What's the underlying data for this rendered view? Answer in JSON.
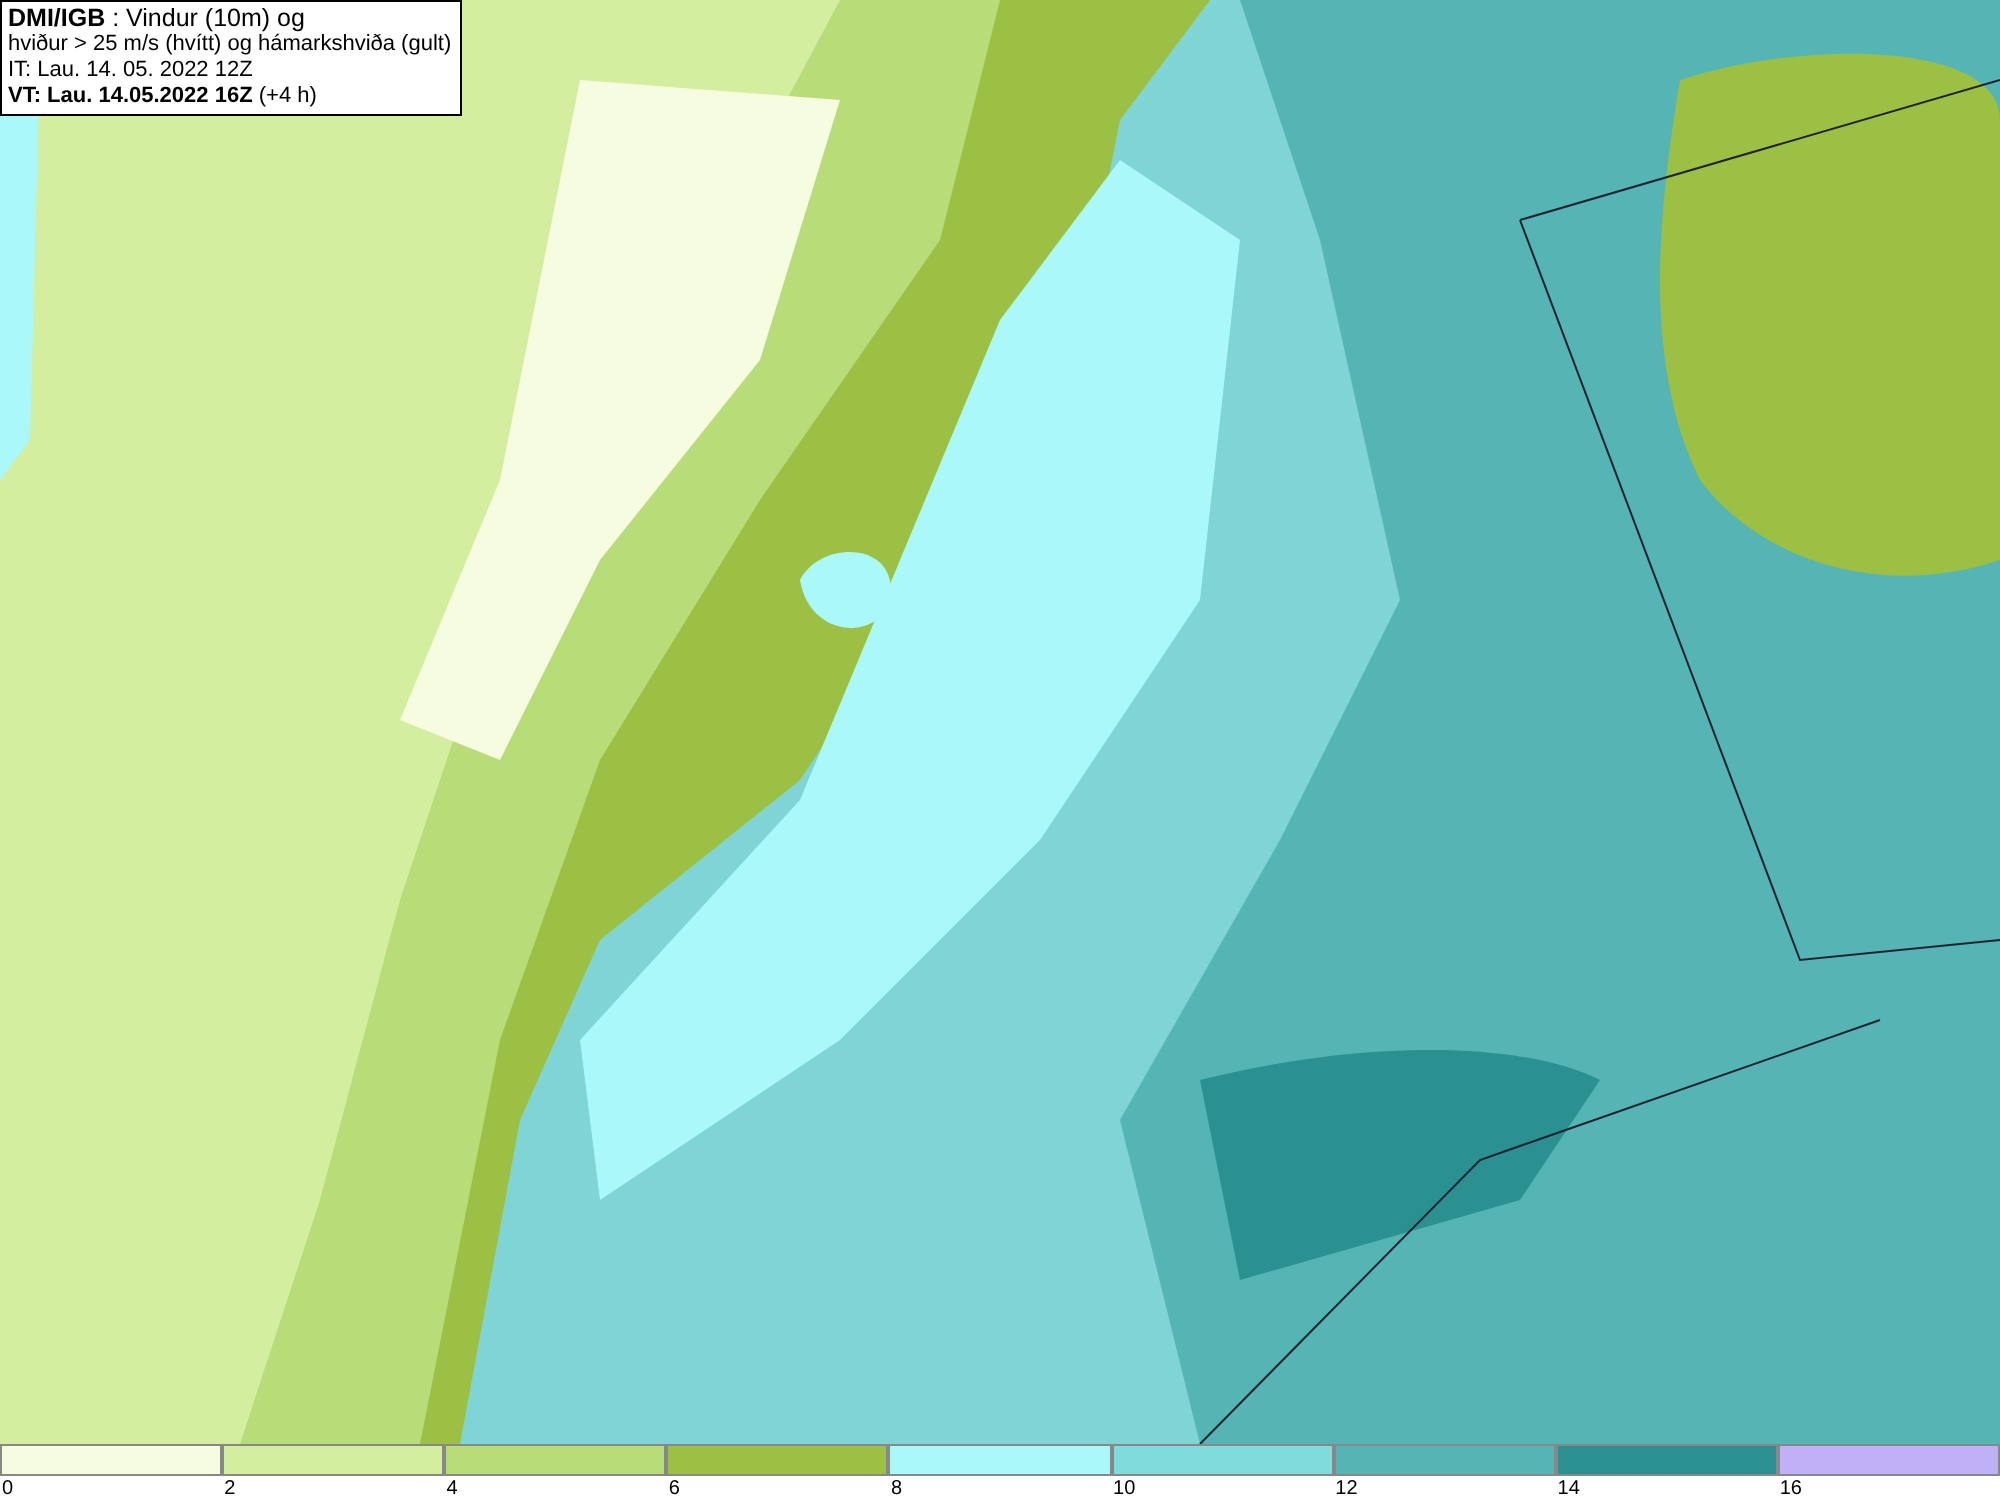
{
  "info_box": {
    "lines": [
      "**DMI/IGB** : Vindur (10m) og",
      "hviður > 25 m/s (hvítt) og hámarkshviða (gult)",
      "IT: Lau. 14. 05. 2022 12Z",
      "**VT: Lau. 14.05.2022 16Z** (+4 h)"
    ]
  },
  "legend": [
    {
      "label": "0",
      "color": "#f5fce0"
    },
    {
      "label": "2",
      "color": "#d4eea0"
    },
    {
      "label": "4",
      "color": "#b8dc78"
    },
    {
      "label": "6",
      "color": "#9cc044"
    },
    {
      "label": "8",
      "color": "#aaf8fa"
    },
    {
      "label": "10",
      "color": "#80dcdc"
    },
    {
      "label": "12",
      "color": "#55b4b4"
    },
    {
      "label": "14",
      "color": "#2a9090"
    },
    {
      "label": "16",
      "color": "#c0b0f8"
    }
  ]
}
